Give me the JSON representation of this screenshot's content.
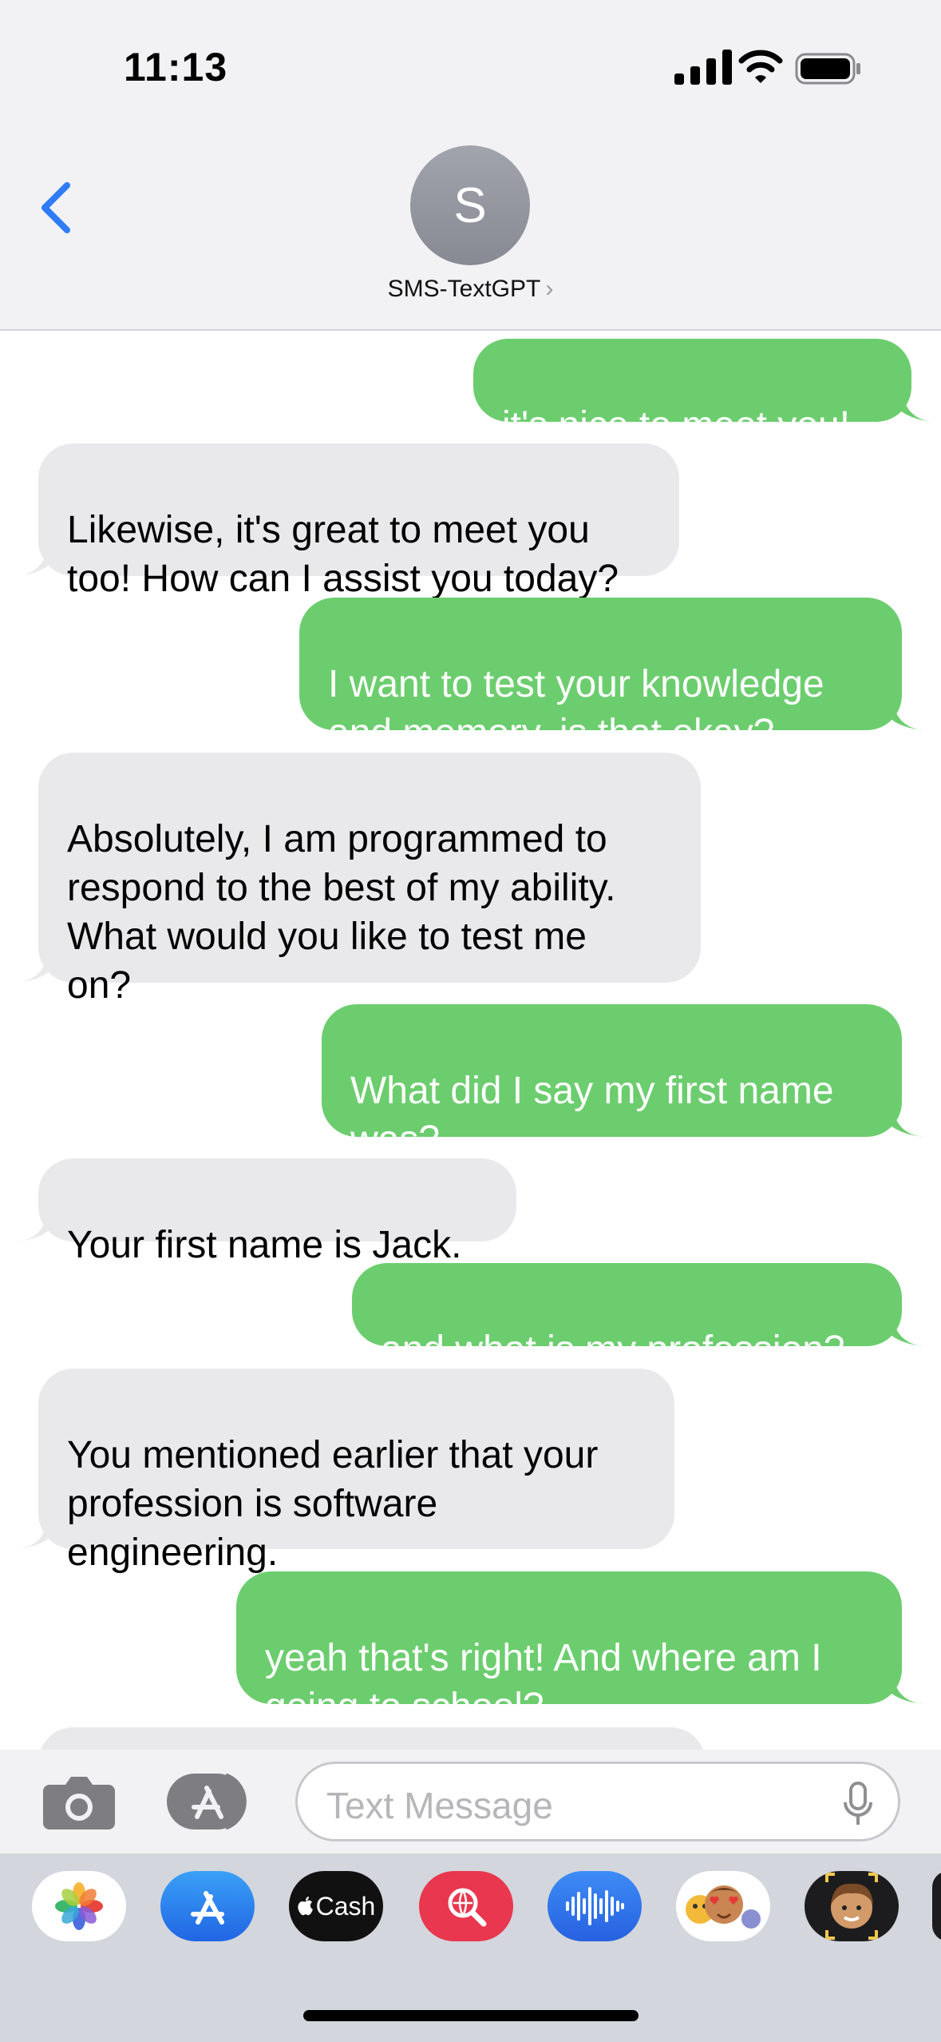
{
  "status_bar": {
    "time": "11:13"
  },
  "header": {
    "avatar_initial": "S",
    "contact_name": "SMS-TextGPT",
    "contact_chevron": "›"
  },
  "messages": [
    {
      "from": "me",
      "text": "it's nice to meet you!"
    },
    {
      "from": "them",
      "text": "Likewise, it's great to meet you\ntoo! How can I assist you today?"
    },
    {
      "from": "me",
      "text": "I want to test your knowledge\nand memory, is that okay?"
    },
    {
      "from": "them",
      "text": "Absolutely, I am programmed to\nrespond to the best of my ability.\nWhat would you like to test me\non?"
    },
    {
      "from": "me",
      "text": "What did I say my first name\nwas?"
    },
    {
      "from": "them",
      "text": "Your first name is Jack."
    },
    {
      "from": "me",
      "text": "and what is my profession?"
    },
    {
      "from": "them",
      "text": "You mentioned earlier that your\nprofession is software\nengineering."
    },
    {
      "from": "me",
      "text": "yeah that's right! And where am I\ngoing to school?"
    }
  ],
  "composer": {
    "placeholder": "Text Message"
  },
  "app_tray": {
    "items": [
      {
        "name": "photos-app-icon"
      },
      {
        "name": "app-store-icon"
      },
      {
        "name": "apple-cash-icon",
        "label": "Cash"
      },
      {
        "name": "image-search-icon"
      },
      {
        "name": "audio-message-icon"
      },
      {
        "name": "memoji-stickers-icon"
      },
      {
        "name": "memoji-icon"
      }
    ]
  },
  "colors": {
    "outgoing_bubble": "#6ccd6e",
    "incoming_bubble": "#e9e9eb",
    "accent": "#2f7cf6"
  }
}
